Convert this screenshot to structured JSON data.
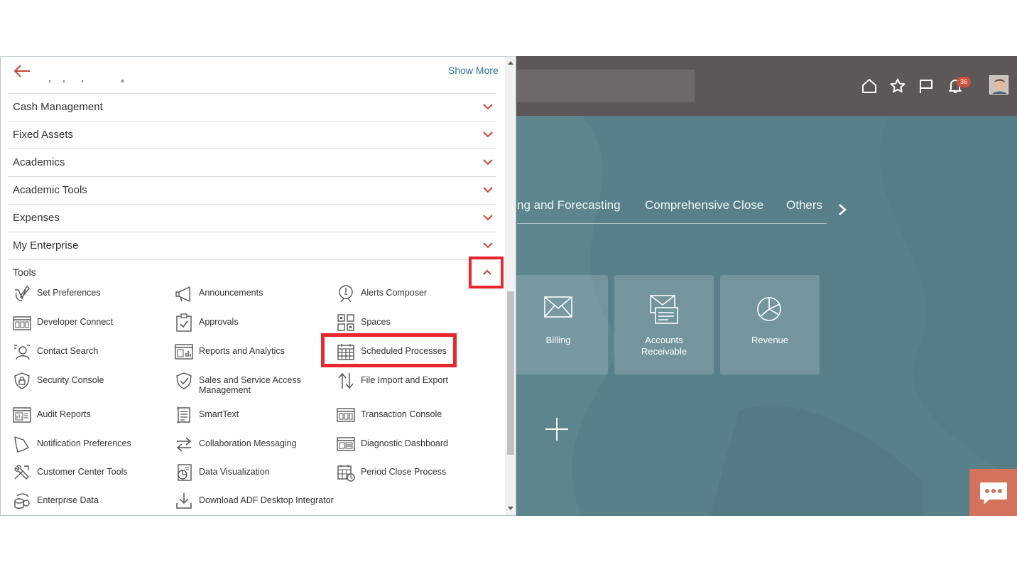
{
  "navigator": {
    "show_more": "Show More",
    "sections": [
      {
        "label": "Cash Management"
      },
      {
        "label": "Fixed Assets"
      },
      {
        "label": "Academics"
      },
      {
        "label": "Academic Tools"
      },
      {
        "label": "Expenses"
      },
      {
        "label": "My Enterprise"
      }
    ],
    "tools": {
      "label": "Tools",
      "items": [
        {
          "label": "Set Preferences",
          "icon": "set-preferences-icon"
        },
        {
          "label": "Announcements",
          "icon": "megaphone-icon"
        },
        {
          "label": "Alerts Composer",
          "icon": "alert-icon"
        },
        {
          "label": "Developer Connect",
          "icon": "developer-connect-icon"
        },
        {
          "label": "Approvals",
          "icon": "clipboard-check-icon"
        },
        {
          "label": "Spaces",
          "icon": "spaces-grid-icon"
        },
        {
          "label": "Contact Search",
          "icon": "contact-search-icon"
        },
        {
          "label": "Reports and Analytics",
          "icon": "reports-icon"
        },
        {
          "label": "Scheduled Processes",
          "icon": "calendar-grid-icon"
        },
        {
          "label": "Security Console",
          "icon": "shield-lock-icon"
        },
        {
          "label": "Sales and Service Access Management",
          "icon": "shield-check-icon"
        },
        {
          "label": "File Import and Export",
          "icon": "import-export-icon"
        },
        {
          "label": "Audit Reports",
          "icon": "audit-reports-icon"
        },
        {
          "label": "SmartText",
          "icon": "smarttext-icon"
        },
        {
          "label": "Transaction Console",
          "icon": "transaction-console-icon"
        },
        {
          "label": "Notification Preferences",
          "icon": "bell-outline-icon"
        },
        {
          "label": "Collaboration Messaging",
          "icon": "exchange-arrows-icon"
        },
        {
          "label": "Diagnostic Dashboard",
          "icon": "diagnostic-dashboard-icon"
        },
        {
          "label": "Customer Center Tools",
          "icon": "tools-icon"
        },
        {
          "label": "Data Visualization",
          "icon": "data-visualization-icon"
        },
        {
          "label": "Period Close Process",
          "icon": "period-close-icon"
        },
        {
          "label": "Enterprise Data",
          "icon": "enterprise-data-icon"
        },
        {
          "label": "Download ADF Desktop Integrator",
          "icon": "download-icon"
        }
      ]
    }
  },
  "app": {
    "tabs": [
      {
        "label": "ng and Forecasting"
      },
      {
        "label": "Comprehensive Close"
      },
      {
        "label": "Others"
      }
    ],
    "tiles": [
      {
        "label": "Billing",
        "icon": "envelope-icon"
      },
      {
        "label": "Accounts Receivable",
        "icon": "invoice-icon"
      },
      {
        "label": "Revenue",
        "icon": "pie-chart-icon"
      }
    ],
    "notification_count": "36"
  },
  "colors": {
    "accent": "#c74634",
    "highlight": "#e8262c",
    "link": "#2a6f9c",
    "header": "#5d5857",
    "background": "#58808a"
  }
}
